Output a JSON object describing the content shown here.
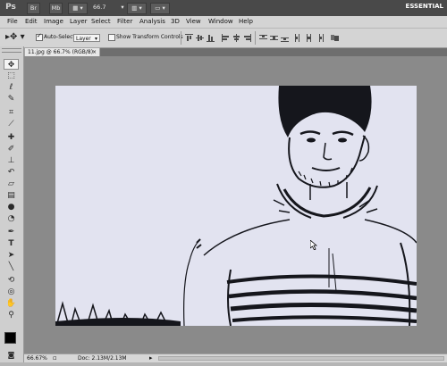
{
  "app": {
    "logo": "Ps",
    "zoom_value": "66.7",
    "workspace": "ESSENTIAL",
    "icons": [
      "bridge-icon",
      "minibridge-icon",
      "view-extras-icon",
      "zoom-icon",
      "arrange-documents-icon",
      "screen-mode-icon"
    ]
  },
  "menu": [
    "File",
    "Edit",
    "Image",
    "Layer",
    "Select",
    "Filter",
    "Analysis",
    "3D",
    "View",
    "Window",
    "Help"
  ],
  "options": {
    "auto_select_label": "Auto-Select:",
    "auto_select_checked": true,
    "auto_select_value": "Layer",
    "show_transform_label": "Show Transform Controls",
    "show_transform_checked": false
  },
  "document": {
    "tab_title": "11.jpg @ 66.7% (RGB/8)",
    "tab_close": "×"
  },
  "status": {
    "zoom": "66.67%",
    "doc_info": "Doc: 2.13M/2.13M"
  },
  "tools": [
    "move-tool-icon",
    "marquee-tool-icon",
    "lasso-tool-icon",
    "quick-selection-tool-icon",
    "crop-tool-icon",
    "eyedropper-tool-icon",
    "spot-healing-tool-icon",
    "brush-tool-icon",
    "clone-stamp-tool-icon",
    "history-brush-tool-icon",
    "eraser-tool-icon",
    "gradient-tool-icon",
    "blur-tool-icon",
    "dodge-tool-icon",
    "pen-tool-icon",
    "type-tool-icon",
    "path-selection-tool-icon",
    "shape-tool-icon",
    "3d-rotate-tool-icon",
    "3d-orbit-tool-icon",
    "hand-tool-icon",
    "zoom-tool-icon"
  ],
  "colors": {
    "canvas_background": "#e2e3f0",
    "sketch_ink": "#15161c",
    "foreground_color": "#000000",
    "background_color": "#ffffff"
  }
}
